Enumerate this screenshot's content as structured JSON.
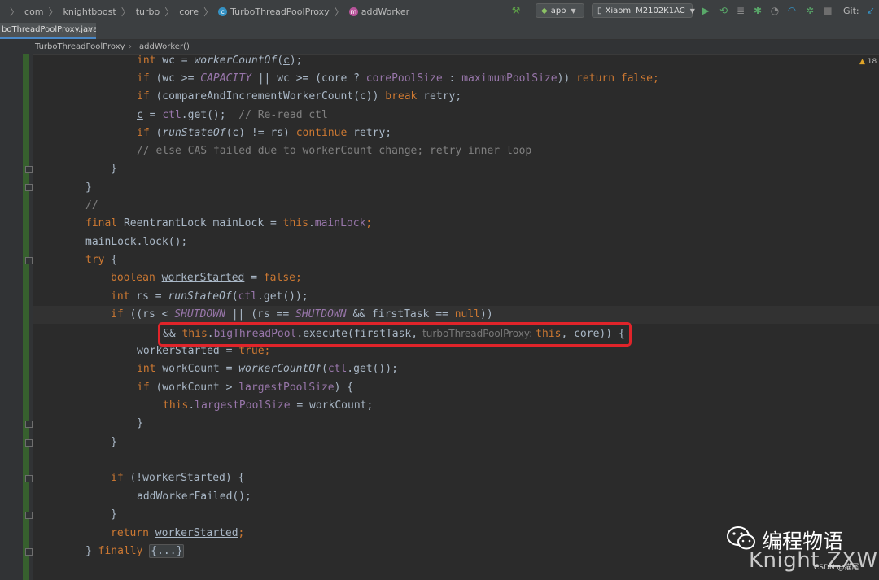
{
  "navbar": {
    "crumbs": [
      "com",
      "knightboost",
      "turbo",
      "core",
      "TurboThreadPoolProxy",
      "addWorker"
    ],
    "run_config": "app",
    "device": "Xiaomi M2102K1AC",
    "git_label": "Git:"
  },
  "tab": {
    "label": "boThreadPoolProxy.java",
    "close": "×"
  },
  "editor_crumbs": [
    "TurboThreadPoolProxy",
    "addWorker()"
  ],
  "warning_count": "18",
  "hint": "turboThreadPoolProxy:",
  "code": {
    "l01": [
      "int",
      " wc = ",
      "workerCountOf",
      "(",
      "c",
      ");"
    ],
    "l02": [
      "if",
      " (wc >= ",
      "CAPACITY",
      " || wc >= (core ? ",
      "corePoolSize",
      " : ",
      "maximumPoolSize",
      ")) ",
      "return false",
      ";"
    ],
    "l03": [
      "if",
      " (compareAndIncrementWorkerCount(c)) ",
      "break",
      " retry;"
    ],
    "l04": [
      "c",
      " = ",
      "ctl",
      ".get();  ",
      "// Re-read ctl"
    ],
    "l05": [
      "if",
      " (",
      "runStateOf",
      "(c) != rs) ",
      "continue",
      " retry;"
    ],
    "l06": "// else CAS failed due to workerCount change; retry inner loop",
    "l07": "}",
    "l08": "}",
    "l09": "//",
    "l10": [
      "final",
      " ReentrantLock mainLock = ",
      "this",
      ".",
      "mainLock",
      ";"
    ],
    "l11": "mainLock.lock();",
    "l12": [
      "try",
      " {"
    ],
    "l13": [
      "boolean",
      " ",
      "workerStarted",
      " = ",
      "false",
      ";"
    ],
    "l14": [
      "int",
      " rs = ",
      "runStateOf",
      "(",
      "ctl",
      ".get());"
    ],
    "l15": [
      "if",
      " ((rs < ",
      "SHUTDOWN",
      " || (rs == ",
      "SHUTDOWN",
      " && firstTask == ",
      "null",
      "))"
    ],
    "l16": [
      "&& ",
      "this",
      ".",
      "bigThreadPool",
      ".execute(firstTask,",
      "this",
      ", core)) {"
    ],
    "l17": [
      "workerStarted",
      " = ",
      "true",
      ";"
    ],
    "l18": [
      "int",
      " workCount = ",
      "workerCountOf",
      "(",
      "ctl",
      ".get());"
    ],
    "l19": [
      "if",
      " (workCount > ",
      "largestPoolSize",
      ") {"
    ],
    "l20": [
      "this",
      ".",
      "largestPoolSize",
      " = workCount;"
    ],
    "l21": "}",
    "l22": "}",
    "l23": [
      "if",
      " (!",
      "workerStarted",
      ") {"
    ],
    "l24": "addWorkerFailed();",
    "l25": "}",
    "l26": [
      "return",
      " ",
      "workerStarted",
      ";"
    ],
    "l27": [
      "} ",
      "finally",
      " ",
      "{...}"
    ]
  },
  "watermark": {
    "title": "编程物语",
    "name": "Knight ZXW",
    "csdn": "CSDN @猫尾"
  }
}
